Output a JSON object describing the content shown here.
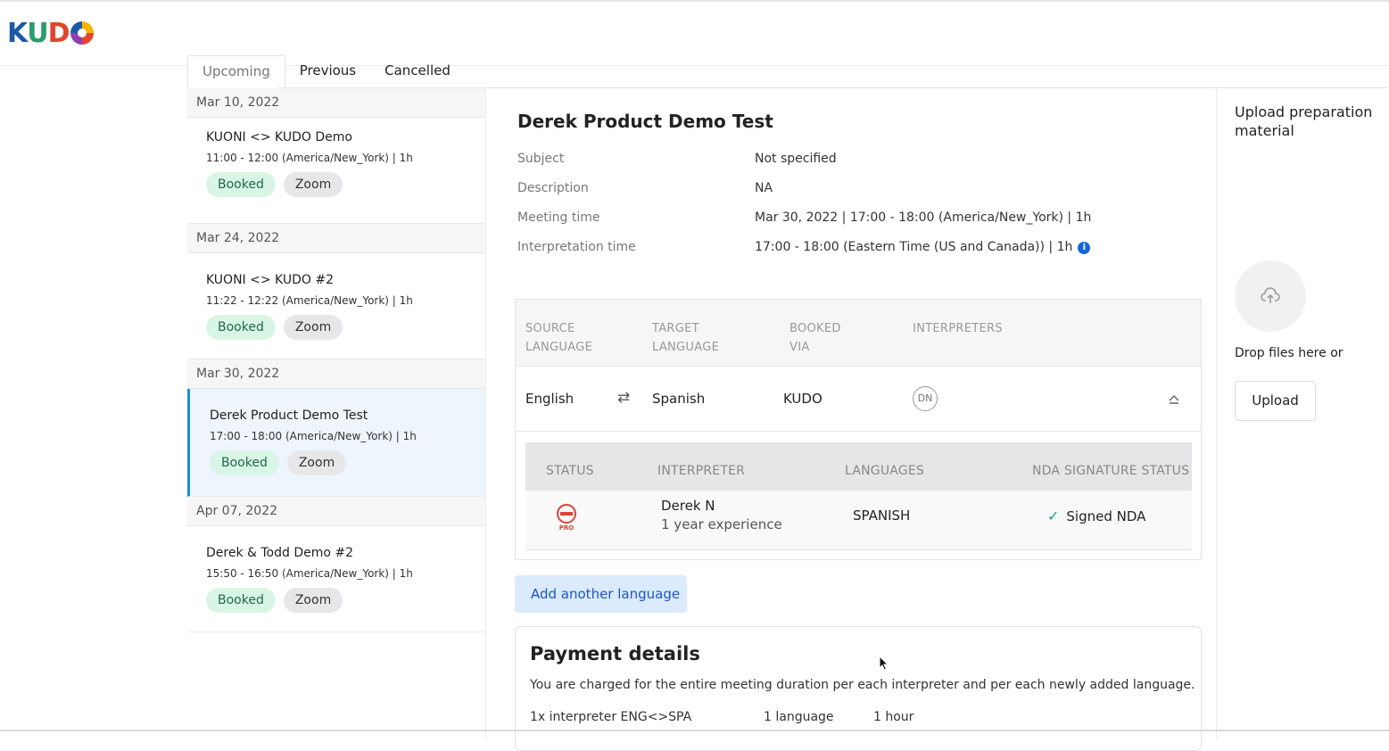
{
  "app": {
    "logo_text": "KUDO"
  },
  "tabs": [
    {
      "label": "Upcoming",
      "active": true
    },
    {
      "label": "Previous",
      "active": false
    },
    {
      "label": "Cancelled",
      "active": false
    }
  ],
  "meetings": [
    {
      "date": "Mar 10, 2022",
      "title": "KUONI <> KUDO Demo",
      "time": "11:00 - 12:00 (America/New_York) | 1h",
      "status": "Booked",
      "platform": "Zoom",
      "selected": false
    },
    {
      "date": "Mar 24, 2022",
      "title": "KUONI <> KUDO #2",
      "time": "11:22 - 12:22 (America/New_York) | 1h",
      "status": "Booked",
      "platform": "Zoom",
      "selected": false
    },
    {
      "date": "Mar 30, 2022",
      "title": "Derek Product Demo Test",
      "time": "17:00 - 18:00 (America/New_York) | 1h",
      "status": "Booked",
      "platform": "Zoom",
      "selected": true
    },
    {
      "date": "Apr 07, 2022",
      "title": "Derek & Todd Demo #2",
      "time": "15:50 - 16:50 (America/New_York) | 1h",
      "status": "Booked",
      "platform": "Zoom",
      "selected": false
    }
  ],
  "detail": {
    "title": "Derek Product Demo Test",
    "fields": [
      {
        "label": "Subject",
        "value": "Not specified"
      },
      {
        "label": "Description",
        "value": "NA"
      },
      {
        "label": "Meeting time",
        "value": "Mar 30, 2022 | 17:00 - 18:00 (America/New_York) | 1h"
      },
      {
        "label": "Interpretation time",
        "value": "17:00 - 18:00 (Eastern Time (US and Canada)) | 1h"
      }
    ],
    "info_icon": "i"
  },
  "language_table": {
    "headers": {
      "source_1": "SOURCE",
      "source_2": "LANGUAGE",
      "target_1": "TARGET",
      "target_2": "LANGUAGE",
      "booked_1": "BOOKED",
      "booked_2": "VIA",
      "interpreters": "INTERPRETERS"
    },
    "row": {
      "source": "English",
      "swap_icon": "⇄",
      "target": "Spanish",
      "booked_via": "KUDO",
      "interpreter_initials": "DN"
    }
  },
  "interpreter_table": {
    "headers": {
      "status": "STATUS",
      "interpreter": "INTERPRETER",
      "languages": "LANGUAGES",
      "nda": "NDA SIGNATURE STATUS"
    },
    "row": {
      "status_badge": "PRO",
      "name": "Derek N",
      "experience": "1 year experience",
      "language": "SPANISH",
      "nda_check": "✓",
      "nda_status": "Signed NDA"
    }
  },
  "add_language_label": "Add another language",
  "payment": {
    "title": "Payment details",
    "description": "You are charged for the entire meeting duration per each interpreter and per each newly added language.",
    "line_item": "1x interpreter ENG<>SPA",
    "languages": "1 language",
    "duration": "1 hour"
  },
  "upload": {
    "title": "Upload preparation material",
    "drop_text": "Drop files here or",
    "button_label": "Upload"
  },
  "colors": {
    "accent": "#1b8fd6",
    "booked_bg": "#d9f5e6",
    "link": "#1a56c9"
  }
}
